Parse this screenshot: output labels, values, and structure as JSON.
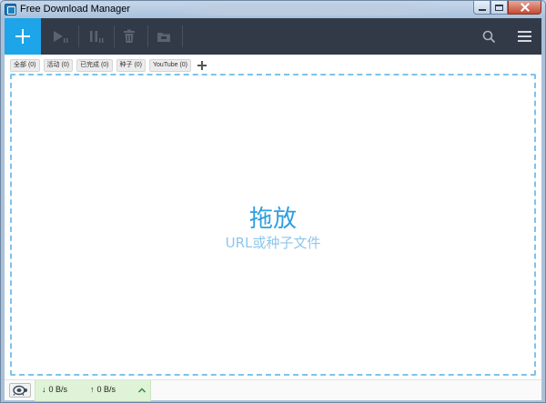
{
  "window": {
    "title": "Free Download Manager"
  },
  "toolbar": {
    "buttons": [
      {
        "icon": "plus-icon",
        "name": "add-download-button"
      },
      {
        "icon": "play-icon",
        "name": "resume-button"
      },
      {
        "icon": "pause-icon",
        "name": "pause-button"
      },
      {
        "icon": "trash-icon",
        "name": "delete-button"
      },
      {
        "icon": "folder-icon",
        "name": "open-folder-button"
      },
      {
        "icon": "search-icon",
        "name": "search-button"
      },
      {
        "icon": "hamburger-menu-icon",
        "name": "main-menu-button"
      }
    ]
  },
  "tabs": [
    {
      "label": "全部 (0)"
    },
    {
      "label": "活动 (0)"
    },
    {
      "label": "已完成 (0)"
    },
    {
      "label": "种子 (0)"
    },
    {
      "label": "YouTube (0)"
    }
  ],
  "dropzone": {
    "title": "拖放",
    "subtitle": "URL或种子文件"
  },
  "status": {
    "download_arrow": "↓",
    "download_speed": "0 B/s",
    "upload_arrow": "↑",
    "upload_speed": "0 B/s"
  },
  "colors": {
    "accent": "#1ea4e9",
    "toolbar_bg": "#323a48",
    "dropzone_border": "#7fc2ea",
    "speed_bg": "#dff3d6"
  }
}
